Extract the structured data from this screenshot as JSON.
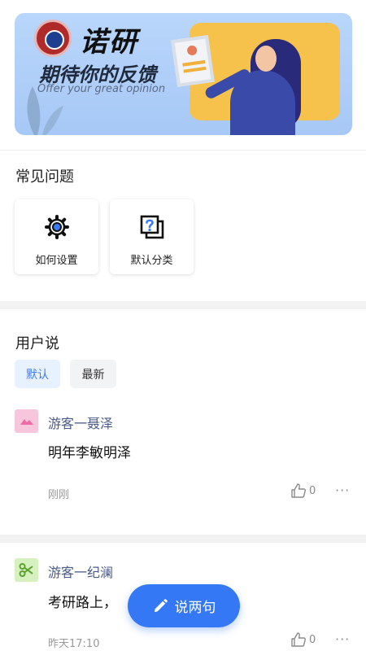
{
  "banner": {
    "brand": "诺研",
    "headline": "期待你的反馈",
    "subline": "Offer your great opinion"
  },
  "faq": {
    "title": "常见问题",
    "items": [
      {
        "label": "如何设置",
        "icon": "gear-icon"
      },
      {
        "label": "默认分类",
        "icon": "help-document-icon"
      }
    ]
  },
  "user_says": {
    "title": "用户说",
    "filters": [
      {
        "label": "默认",
        "selected": true
      },
      {
        "label": "最新",
        "selected": false
      }
    ],
    "posts": [
      {
        "author": "游客一聂泽",
        "content": "明年李敏明泽",
        "time": "刚刚",
        "likes": "0",
        "avatar_color": "#f7c6dd",
        "avatar_icon": "landscape-icon"
      },
      {
        "author": "游客一纪澜",
        "content": "考研路上，",
        "time": "昨天17:10",
        "likes": "0",
        "avatar_color": "#d6f1bf",
        "avatar_icon": "scissors-icon"
      }
    ]
  },
  "fab": {
    "label": "说两句",
    "icon": "pencil-icon"
  },
  "colors": {
    "accent": "#3478f6",
    "chip_active_bg": "#e8f1ff",
    "name_color": "#4a5a86"
  }
}
